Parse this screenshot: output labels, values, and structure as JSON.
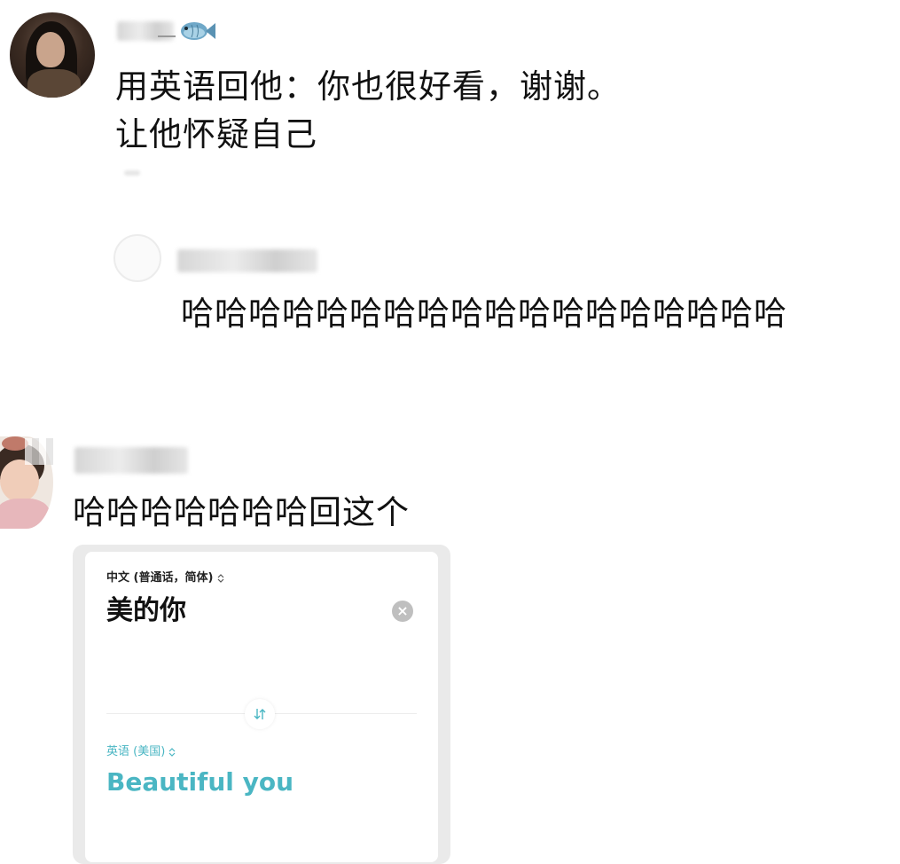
{
  "comments": [
    {
      "name_obscured": true,
      "text_lines": [
        "用英语回他：你也很好看，谢谢。",
        "让他怀疑自己"
      ]
    },
    {
      "name_obscured": true,
      "text_lines": [
        "哈哈哈哈哈哈哈哈哈哈哈哈哈哈哈哈哈哈"
      ]
    },
    {
      "name_obscured": true,
      "text_lines": [
        "哈哈哈哈哈哈哈回这个"
      ]
    }
  ],
  "translate_card": {
    "source_language": "中文 (普通话，简体)",
    "source_text": "美的你",
    "clear_glyph": "×",
    "target_language": "英语 (美国)",
    "target_text": "Beautiful you",
    "accent_color": "#4ab6c3"
  },
  "icons": [
    "fish-icon",
    "clear-icon",
    "swap-icon",
    "chevron-updown-icon"
  ]
}
